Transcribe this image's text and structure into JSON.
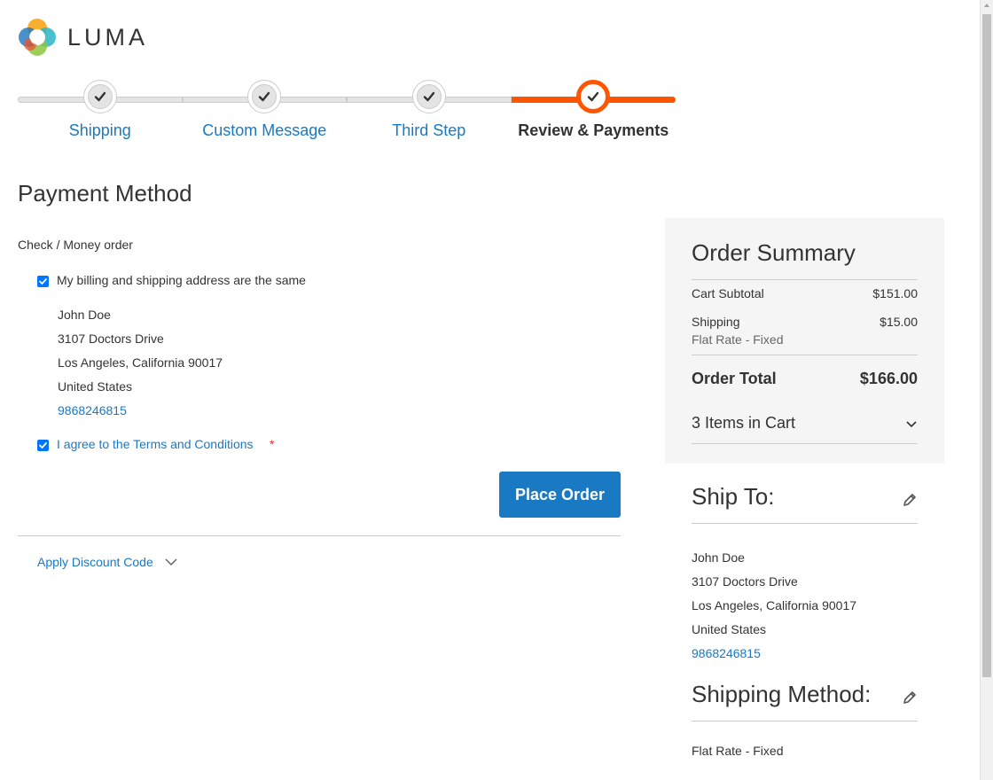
{
  "logo": {
    "text": "LUMA"
  },
  "progress": {
    "steps": [
      {
        "label": "Shipping",
        "complete": true,
        "active": false
      },
      {
        "label": "Custom Message",
        "complete": true,
        "active": false
      },
      {
        "label": "Third Step",
        "complete": true,
        "active": false
      },
      {
        "label": "Review & Payments",
        "complete": true,
        "active": true
      }
    ]
  },
  "payment": {
    "title": "Payment Method",
    "method_title": "Check / Money order",
    "billing_same_label": "My billing and shipping address are the same",
    "billing_same_checked": true,
    "address": {
      "name": "John Doe",
      "street": "3107 Doctors Drive",
      "city_line": "Los Angeles, California 90017",
      "country": "United States",
      "phone": "9868246815"
    },
    "terms_label": "I agree to the Terms and Conditions",
    "terms_required_mark": "*",
    "terms_checked": true,
    "place_order_label": "Place Order",
    "discount_label": "Apply Discount Code"
  },
  "summary": {
    "title": "Order Summary",
    "subtotal_label": "Cart Subtotal",
    "subtotal_value": "$151.00",
    "shipping_label": "Shipping",
    "shipping_value": "$15.00",
    "shipping_method": "Flat Rate - Fixed",
    "total_label": "Order Total",
    "total_value": "$166.00",
    "items_in_cart": "3 Items in Cart"
  },
  "ship_to": {
    "title": "Ship To:",
    "address": {
      "name": "John Doe",
      "street": "3107 Doctors Drive",
      "city_line": "Los Angeles, California 90017",
      "country": "United States",
      "phone": "9868246815"
    }
  },
  "shipping_method": {
    "title": "Shipping Method:",
    "value": "Flat Rate - Fixed"
  },
  "colors": {
    "link": "#1979c3",
    "accent": "#ff5501",
    "required": "#e02b27",
    "summary_bg": "#f5f5f5"
  }
}
